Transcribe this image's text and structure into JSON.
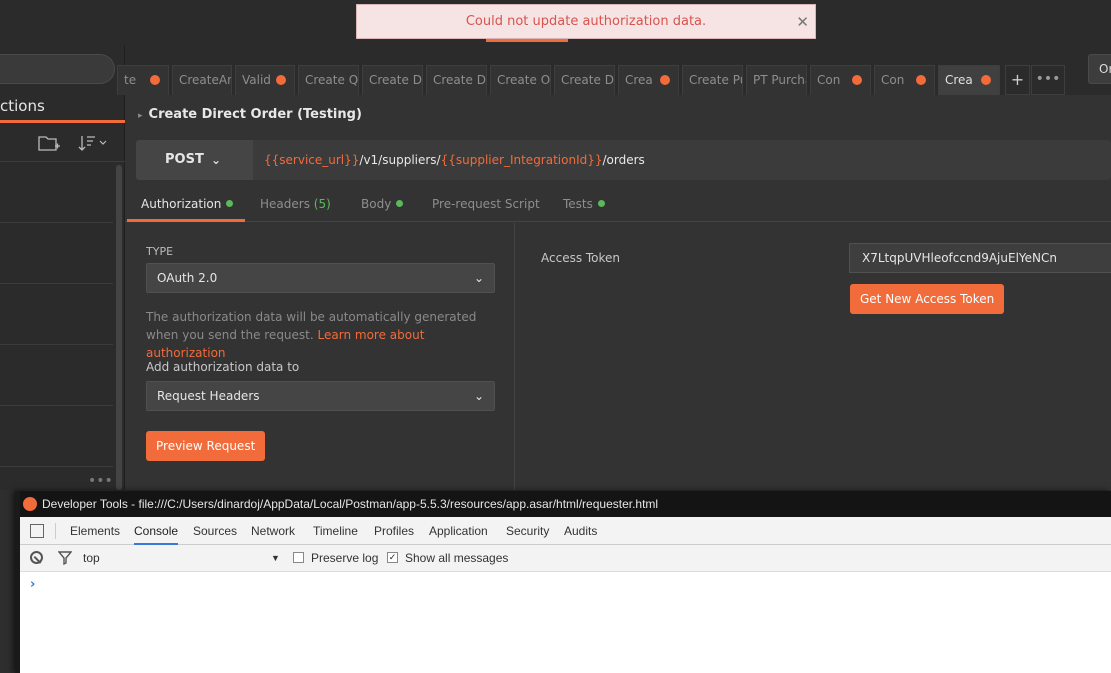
{
  "toast": {
    "message": "Could not update authorization data.",
    "close_glyph": "✕"
  },
  "sidebar": {
    "title": "ctions",
    "more_glyph": "•••"
  },
  "tabs": {
    "items": [
      {
        "label": "te",
        "dot": true
      },
      {
        "label": "CreateAnd",
        "dot": false
      },
      {
        "label": "Valid",
        "dot": true
      },
      {
        "label": "Create Qu",
        "dot": false
      },
      {
        "label": "Create Dir",
        "dot": false
      },
      {
        "label": "Create Dir",
        "dot": false
      },
      {
        "label": "Create Or",
        "dot": false
      },
      {
        "label": "Create Dir",
        "dot": false
      },
      {
        "label": "Crea",
        "dot": true
      },
      {
        "label": "Create Pu",
        "dot": false
      },
      {
        "label": "PT Purcha",
        "dot": false
      },
      {
        "label": "Con",
        "dot": true
      },
      {
        "label": "Con",
        "dot": true
      },
      {
        "label": "Crea",
        "dot": true
      }
    ],
    "add_glyph": "+",
    "more_glyph": "•••",
    "env_label": "Or"
  },
  "request": {
    "title": "Create Direct Order (Testing)",
    "caret": "▸",
    "method": "POST",
    "method_chevron": "⌄",
    "url": {
      "part1": "{{service_url}}",
      "part2": "/v1/suppliers/",
      "part3": "{{supplier_IntegrationId}}",
      "part4": "/orders"
    }
  },
  "subtabs": {
    "authorization": "Authorization",
    "headers": "Headers",
    "headers_count": "(5)",
    "body": "Body",
    "prerequest": "Pre-request Script",
    "tests": "Tests"
  },
  "auth": {
    "type_label": "TYPE",
    "type_value": "OAuth 2.0",
    "description": "The authorization data will be automatically generated when you send the request.",
    "learn_more": "Learn more about authorization",
    "add_to_label": "Add authorization data to",
    "add_to_value": "Request Headers",
    "preview_button": "Preview Request",
    "access_token_label": "Access Token",
    "access_token_value": "X7LtqpUVHleofccnd9AjuElYeNCn",
    "get_token_button": "Get New Access Token",
    "chevron": "⌄"
  },
  "devtools": {
    "title": "Developer Tools - file:///C:/Users/dinardoj/AppData/Local/Postman/app-5.5.3/resources/app.asar/html/requester.html",
    "tabs": [
      "Elements",
      "Console",
      "Sources",
      "Network",
      "Timeline",
      "Profiles",
      "Application",
      "Security",
      "Audits"
    ],
    "active_tab": "Console",
    "context": "top",
    "context_arrow": "▼",
    "preserve_log": "Preserve log",
    "show_all": "Show all messages",
    "check_glyph": "✓",
    "prompt": "›"
  },
  "colors": {
    "accent": "#f26b3a",
    "green": "#5cb85c",
    "error_text": "#d9534f",
    "devtools_blue": "#3879d9"
  }
}
